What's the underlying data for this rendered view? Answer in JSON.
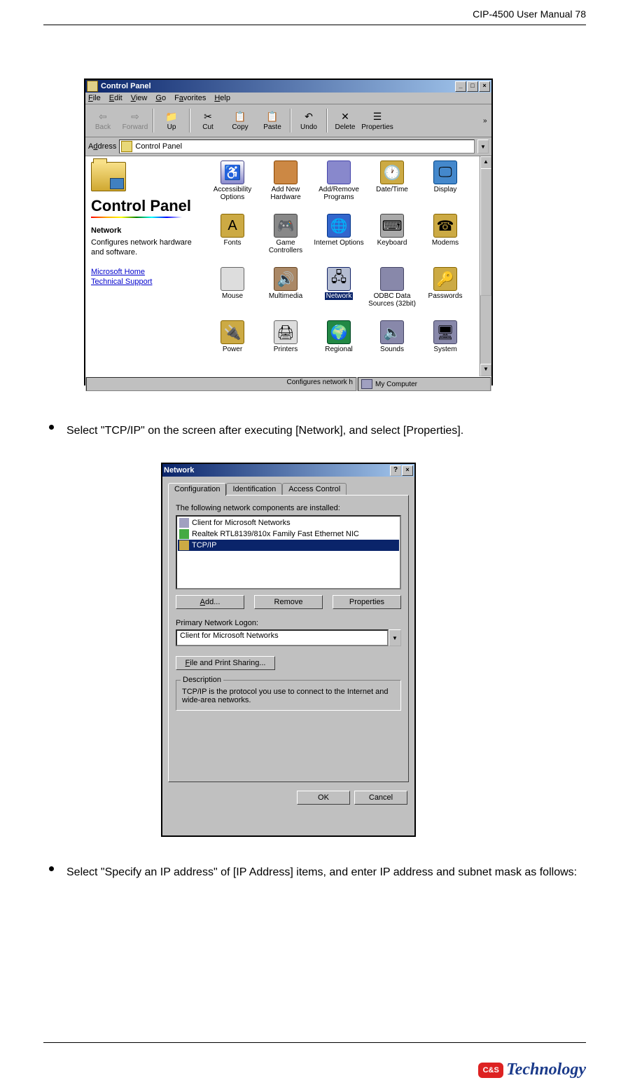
{
  "header": {
    "text": "CIP-4500 User Manual 78"
  },
  "footer": {
    "logo_badge": "C&S",
    "logo_text": "Technology"
  },
  "bullets": {
    "b1": "Select \"TCP/IP\" on the screen after executing [Network], and select [Properties].",
    "b2": "Select \"Specify an IP address\" of [IP Address] items, and enter IP address and subnet mask as follows:"
  },
  "cp": {
    "title": "Control Panel",
    "menus": {
      "file": "File",
      "edit": "Edit",
      "view": "View",
      "go": "Go",
      "fav": "Favorites",
      "help": "Help"
    },
    "tb": {
      "back": "Back",
      "forward": "Forward",
      "up": "Up",
      "cut": "Cut",
      "copy": "Copy",
      "paste": "Paste",
      "undo": "Undo",
      "delete": "Delete",
      "prop": "Properties"
    },
    "addr_label": "Address",
    "addr_value": "Control Panel",
    "left": {
      "h": "Control Panel",
      "sel": "Network",
      "desc": "Configures network hardware and software.",
      "link1": "Microsoft Home",
      "link2": "Technical Support"
    },
    "items": [
      {
        "lbl": "Accessibility Options",
        "key": "acc"
      },
      {
        "lbl": "Add New Hardware",
        "key": "hw"
      },
      {
        "lbl": "Add/Remove Programs",
        "key": "arp"
      },
      {
        "lbl": "Date/Time",
        "key": "dt"
      },
      {
        "lbl": "Display",
        "key": "disp"
      },
      {
        "lbl": "Fonts",
        "key": "font"
      },
      {
        "lbl": "Game Controllers",
        "key": "game"
      },
      {
        "lbl": "Internet Options",
        "key": "inet"
      },
      {
        "lbl": "Keyboard",
        "key": "kbd"
      },
      {
        "lbl": "Modems",
        "key": "modem"
      },
      {
        "lbl": "Mouse",
        "key": "mouse"
      },
      {
        "lbl": "Multimedia",
        "key": "mm"
      },
      {
        "lbl": "Network",
        "key": "net",
        "sel": true
      },
      {
        "lbl": "ODBC Data Sources (32bit)",
        "key": "odbc"
      },
      {
        "lbl": "Passwords",
        "key": "pwd"
      },
      {
        "lbl": "Power",
        "key": "pwr"
      },
      {
        "lbl": "Printers",
        "key": "prn"
      },
      {
        "lbl": "Regional",
        "key": "reg"
      },
      {
        "lbl": "Sounds",
        "key": "snd"
      },
      {
        "lbl": "System",
        "key": "sys"
      }
    ],
    "status1": "Configures network h",
    "status2": "My Computer"
  },
  "net": {
    "title": "Network",
    "tabs": {
      "config": "Configuration",
      "ident": "Identification",
      "access": "Access Control"
    },
    "lbl_installed": "The following network components are installed:",
    "list": {
      "client": "Client for Microsoft Networks",
      "nic": "Realtek RTL8139/810x Family Fast Ethernet NIC",
      "tcpip": "TCP/IP"
    },
    "btns": {
      "add": "Add...",
      "remove": "Remove",
      "prop": "Properties"
    },
    "lbl_logon": "Primary Network Logon:",
    "logon_value": "Client for Microsoft Networks",
    "fps": "File and Print Sharing...",
    "desc_title": "Description",
    "desc_text": "TCP/IP is the protocol you use to connect to the Internet and wide-area networks.",
    "ok": "OK",
    "cancel": "Cancel"
  }
}
